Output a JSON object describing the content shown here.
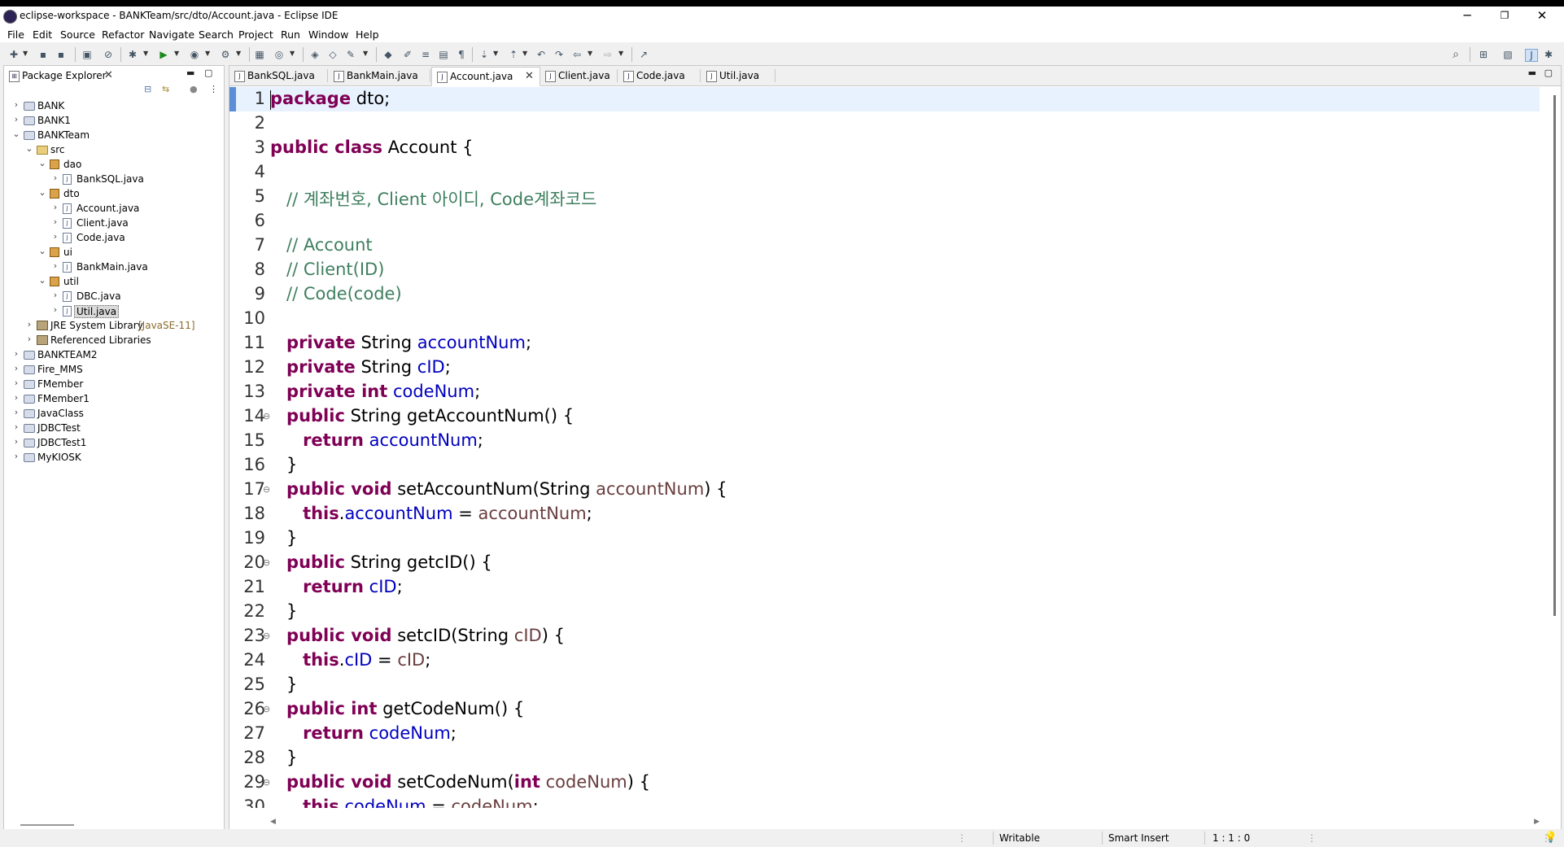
{
  "window": {
    "title": "eclipse-workspace - BANKTeam/src/dto/Account.java - Eclipse IDE",
    "controls": {
      "minimize": "─",
      "restore": "❐",
      "close": "✕"
    }
  },
  "menu": [
    "File",
    "Edit",
    "Source",
    "Refactor",
    "Navigate",
    "Search",
    "Project",
    "Run",
    "Window",
    "Help"
  ],
  "package_explorer": {
    "title": "Package Explorer",
    "tree": [
      {
        "label": "BANK",
        "type": "project",
        "depth": 0,
        "state": "collapsed"
      },
      {
        "label": "BANK1",
        "type": "project",
        "depth": 0,
        "state": "collapsed"
      },
      {
        "label": "BANKTeam",
        "type": "project",
        "depth": 0,
        "state": "expanded"
      },
      {
        "label": "src",
        "type": "src",
        "depth": 1,
        "state": "expanded"
      },
      {
        "label": "dao",
        "type": "package",
        "depth": 2,
        "state": "expanded"
      },
      {
        "label": "BankSQL.java",
        "type": "java",
        "depth": 3,
        "state": "collapsed"
      },
      {
        "label": "dto",
        "type": "package",
        "depth": 2,
        "state": "expanded"
      },
      {
        "label": "Account.java",
        "type": "java",
        "depth": 3,
        "state": "collapsed"
      },
      {
        "label": "Client.java",
        "type": "java",
        "depth": 3,
        "state": "collapsed"
      },
      {
        "label": "Code.java",
        "type": "java",
        "depth": 3,
        "state": "collapsed"
      },
      {
        "label": "ui",
        "type": "package",
        "depth": 2,
        "state": "expanded"
      },
      {
        "label": "BankMain.java",
        "type": "java",
        "depth": 3,
        "state": "collapsed"
      },
      {
        "label": "util",
        "type": "package",
        "depth": 2,
        "state": "expanded"
      },
      {
        "label": "DBC.java",
        "type": "java",
        "depth": 3,
        "state": "collapsed"
      },
      {
        "label": "Util.java",
        "type": "java",
        "depth": 3,
        "state": "collapsed",
        "selected": true
      },
      {
        "label": "JRE System Library",
        "sub": "[JavaSE-11]",
        "type": "library",
        "depth": 1,
        "state": "collapsed"
      },
      {
        "label": "Referenced Libraries",
        "type": "library",
        "depth": 1,
        "state": "collapsed"
      },
      {
        "label": "BANKTEAM2",
        "type": "project",
        "depth": 0,
        "state": "collapsed"
      },
      {
        "label": "Fire_MMS",
        "type": "project",
        "depth": 0,
        "state": "collapsed"
      },
      {
        "label": "FMember",
        "type": "project",
        "depth": 0,
        "state": "collapsed"
      },
      {
        "label": "FMember1",
        "type": "project",
        "depth": 0,
        "state": "collapsed"
      },
      {
        "label": "JavaClass",
        "type": "project",
        "depth": 0,
        "state": "collapsed"
      },
      {
        "label": "JDBCTest",
        "type": "project",
        "depth": 0,
        "state": "collapsed"
      },
      {
        "label": "JDBCTest1",
        "type": "project",
        "depth": 0,
        "state": "collapsed"
      },
      {
        "label": "MyKIOSK",
        "type": "project",
        "depth": 0,
        "state": "collapsed"
      }
    ]
  },
  "editor": {
    "tabs": [
      {
        "label": "BankSQL.java",
        "active": false
      },
      {
        "label": "BankMain.java",
        "active": false
      },
      {
        "label": "Account.java",
        "active": true
      },
      {
        "label": "Client.java",
        "active": false
      },
      {
        "label": "Code.java",
        "active": false
      },
      {
        "label": "Util.java",
        "active": false
      }
    ],
    "lines": [
      {
        "n": "1",
        "tokens": [
          [
            "kw",
            "package"
          ],
          [
            "t",
            " dto;"
          ]
        ],
        "current": true
      },
      {
        "n": "2",
        "tokens": []
      },
      {
        "n": "3",
        "tokens": [
          [
            "kw",
            "public class"
          ],
          [
            "t",
            " Account {"
          ]
        ]
      },
      {
        "n": "4",
        "tokens": []
      },
      {
        "n": "5",
        "tokens": [
          [
            "t",
            "   "
          ],
          [
            "cmt",
            "// 계좌번호, Client 아이디, Code계좌코드"
          ]
        ]
      },
      {
        "n": "6",
        "tokens": []
      },
      {
        "n": "7",
        "tokens": [
          [
            "t",
            "   "
          ],
          [
            "cmt",
            "// Account"
          ]
        ]
      },
      {
        "n": "8",
        "tokens": [
          [
            "t",
            "   "
          ],
          [
            "cmt",
            "// Client(ID)"
          ]
        ]
      },
      {
        "n": "9",
        "tokens": [
          [
            "t",
            "   "
          ],
          [
            "cmt",
            "// Code(code)"
          ]
        ]
      },
      {
        "n": "10",
        "tokens": []
      },
      {
        "n": "11",
        "tokens": [
          [
            "t",
            "   "
          ],
          [
            "kw",
            "private"
          ],
          [
            "t",
            " String "
          ],
          [
            "fld",
            "accountNum"
          ],
          [
            "t",
            ";"
          ]
        ]
      },
      {
        "n": "12",
        "tokens": [
          [
            "t",
            "   "
          ],
          [
            "kw",
            "private"
          ],
          [
            "t",
            " String "
          ],
          [
            "fld",
            "cID"
          ],
          [
            "t",
            ";"
          ]
        ]
      },
      {
        "n": "13",
        "tokens": [
          [
            "t",
            "   "
          ],
          [
            "kw",
            "private int"
          ],
          [
            "t",
            " "
          ],
          [
            "fld",
            "codeNum"
          ],
          [
            "t",
            ";"
          ]
        ]
      },
      {
        "n": "14",
        "fold": "⊖",
        "tokens": [
          [
            "t",
            "   "
          ],
          [
            "kw",
            "public"
          ],
          [
            "t",
            " String getAccountNum() {"
          ]
        ]
      },
      {
        "n": "15",
        "tokens": [
          [
            "t",
            "      "
          ],
          [
            "kw",
            "return"
          ],
          [
            "t",
            " "
          ],
          [
            "fld",
            "accountNum"
          ],
          [
            "t",
            ";"
          ]
        ]
      },
      {
        "n": "16",
        "tokens": [
          [
            "t",
            "   }"
          ]
        ]
      },
      {
        "n": "17",
        "fold": "⊖",
        "tokens": [
          [
            "t",
            "   "
          ],
          [
            "kw",
            "public void"
          ],
          [
            "t",
            " setAccountNum(String "
          ],
          [
            "prm",
            "accountNum"
          ],
          [
            "t",
            ") {"
          ]
        ]
      },
      {
        "n": "18",
        "tokens": [
          [
            "t",
            "      "
          ],
          [
            "kw",
            "this"
          ],
          [
            "t",
            "."
          ],
          [
            "fld",
            "accountNum"
          ],
          [
            "t",
            " = "
          ],
          [
            "prm",
            "accountNum"
          ],
          [
            "t",
            ";"
          ]
        ]
      },
      {
        "n": "19",
        "tokens": [
          [
            "t",
            "   }"
          ]
        ]
      },
      {
        "n": "20",
        "fold": "⊖",
        "tokens": [
          [
            "t",
            "   "
          ],
          [
            "kw",
            "public"
          ],
          [
            "t",
            " String getcID() {"
          ]
        ]
      },
      {
        "n": "21",
        "tokens": [
          [
            "t",
            "      "
          ],
          [
            "kw",
            "return"
          ],
          [
            "t",
            " "
          ],
          [
            "fld",
            "cID"
          ],
          [
            "t",
            ";"
          ]
        ]
      },
      {
        "n": "22",
        "tokens": [
          [
            "t",
            "   }"
          ]
        ]
      },
      {
        "n": "23",
        "fold": "⊖",
        "tokens": [
          [
            "t",
            "   "
          ],
          [
            "kw",
            "public void"
          ],
          [
            "t",
            " setcID(String "
          ],
          [
            "prm",
            "cID"
          ],
          [
            "t",
            ") {"
          ]
        ]
      },
      {
        "n": "24",
        "tokens": [
          [
            "t",
            "      "
          ],
          [
            "kw",
            "this"
          ],
          [
            "t",
            "."
          ],
          [
            "fld",
            "cID"
          ],
          [
            "t",
            " = "
          ],
          [
            "prm",
            "cID"
          ],
          [
            "t",
            ";"
          ]
        ]
      },
      {
        "n": "25",
        "tokens": [
          [
            "t",
            "   }"
          ]
        ]
      },
      {
        "n": "26",
        "fold": "⊖",
        "tokens": [
          [
            "t",
            "   "
          ],
          [
            "kw",
            "public int"
          ],
          [
            "t",
            " getCodeNum() {"
          ]
        ]
      },
      {
        "n": "27",
        "tokens": [
          [
            "t",
            "      "
          ],
          [
            "kw",
            "return"
          ],
          [
            "t",
            " "
          ],
          [
            "fld",
            "codeNum"
          ],
          [
            "t",
            ";"
          ]
        ]
      },
      {
        "n": "28",
        "tokens": [
          [
            "t",
            "   }"
          ]
        ]
      },
      {
        "n": "29",
        "fold": "⊖",
        "tokens": [
          [
            "t",
            "   "
          ],
          [
            "kw",
            "public void"
          ],
          [
            "t",
            " setCodeNum("
          ],
          [
            "kw",
            "int"
          ],
          [
            "t",
            " "
          ],
          [
            "prm",
            "codeNum"
          ],
          [
            "t",
            ") {"
          ]
        ]
      },
      {
        "n": "30",
        "tokens": [
          [
            "t",
            "      "
          ],
          [
            "kw",
            "this"
          ],
          [
            "t",
            "."
          ],
          [
            "fld",
            "codeNum"
          ],
          [
            "t",
            " = "
          ],
          [
            "prm",
            "codeNum"
          ],
          [
            "t",
            ";"
          ]
        ]
      }
    ]
  },
  "status": {
    "mode": "Writable",
    "insert": "Smart Insert",
    "position": "1 : 1 : 0"
  },
  "colors": {
    "keyword": "#7f0055",
    "field": "#0000c0",
    "parameter": "#6a3e3e",
    "comment": "#3f7f5f",
    "current_line": "#e8f2fe"
  }
}
